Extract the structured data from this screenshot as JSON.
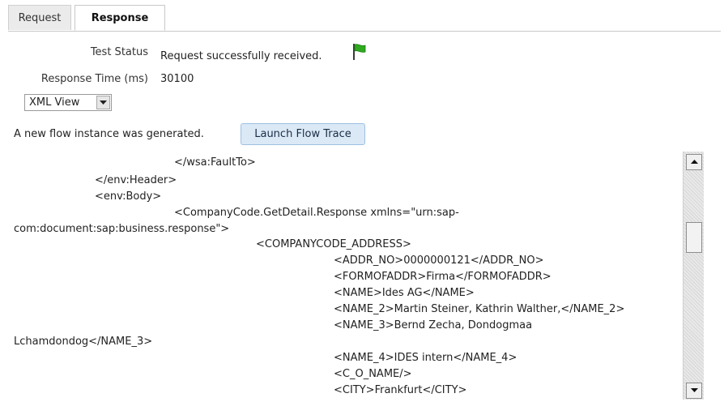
{
  "tabs": [
    {
      "label": "Request",
      "active": false
    },
    {
      "label": "Response",
      "active": true
    }
  ],
  "test_status": {
    "label": "Test Status",
    "value": "Request successfully received.",
    "icon": "green-flag-icon",
    "color": "#2faa1f"
  },
  "response_time": {
    "label": "Response Time (ms)",
    "value": "30100"
  },
  "view_select": {
    "selected": "XML View"
  },
  "flow": {
    "message": "A new flow instance was generated.",
    "button_label": "Launch Flow Trace"
  },
  "xml_lines": [
    "</wsa:FaultTo>",
    "</env:Header>",
    "<env:Body>",
    "<CompanyCode.GetDetail.Response xmlns=\"urn:sap-",
    "com:document:sap:business.response\">",
    "<COMPANYCODE_ADDRESS>",
    "<ADDR_NO>0000000121</ADDR_NO>",
    "<FORMOFADDR>Firma</FORMOFADDR>",
    "<NAME>Ides AG</NAME>",
    "<NAME_2>Martin Steiner, Kathrin Walther,</NAME_2>",
    "<NAME_3>Bernd Zecha, Dondogmaa",
    "Lchamdondog</NAME_3>",
    "<NAME_4>IDES intern</NAME_4>",
    "<C_O_NAME/>",
    "<CITY>Frankfurt</CITY>"
  ]
}
